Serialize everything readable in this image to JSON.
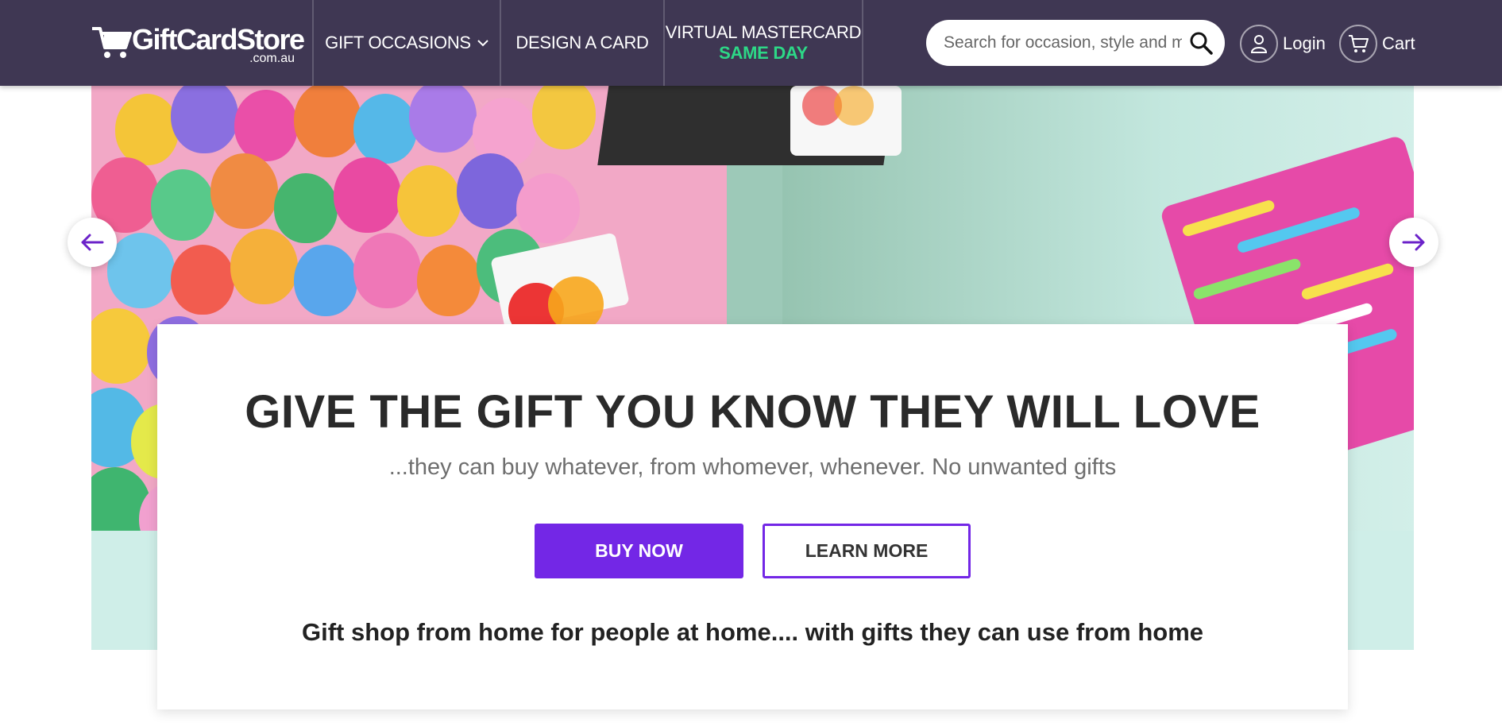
{
  "header": {
    "logo": {
      "main": "GiftCardStore",
      "sub": ".com.au"
    },
    "nav": {
      "occasions": "GIFT OCCASIONS",
      "design": "DESIGN A CARD",
      "mastercard_title": "VIRTUAL MASTERCARD",
      "mastercard_sub": "SAME DAY"
    },
    "search": {
      "placeholder": "Search for occasion, style and more"
    },
    "login": "Login",
    "cart": "Cart"
  },
  "hero": {
    "title": "GIVE THE GIFT YOU KNOW THEY WILL LOVE",
    "subtitle": "...they can buy whatever, from whomever, whenever. No unwanted gifts",
    "buy_now": "BUY NOW",
    "learn_more": "LEARN MORE",
    "tagline": "Gift shop from home for people at home.... with gifts they can use from home"
  },
  "icons": {
    "logo": "shopping-cart-logo-icon",
    "nav_dropdown": "chevron-down-icon",
    "search": "search-icon",
    "login": "user-icon",
    "cart": "cart-icon",
    "prev": "arrow-left-icon",
    "next": "arrow-right-icon"
  },
  "colors": {
    "header_bg": "#3f3753",
    "accent_green": "#2dd887",
    "primary_purple": "#7327e6"
  }
}
